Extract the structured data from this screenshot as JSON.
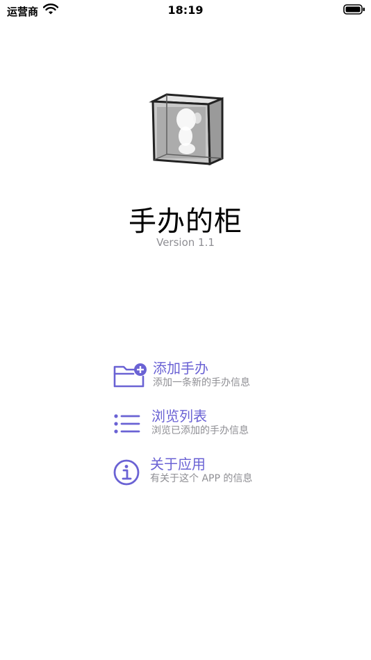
{
  "status": {
    "carrier": "运营商",
    "time": "18:19"
  },
  "app": {
    "title": "手办的柜",
    "version": "Version 1.1"
  },
  "menu": [
    {
      "label": "添加手办",
      "sub": "添加一条新的手办信息",
      "icon": "folder-add-icon"
    },
    {
      "label": "浏览列表",
      "sub": "浏览已添加的手办信息",
      "icon": "list-icon"
    },
    {
      "label": "关于应用",
      "sub": "有关于这个 APP 的信息",
      "icon": "info-icon"
    }
  ],
  "colors": {
    "accent": "#6a62d4",
    "subtext": "#8e8e93"
  }
}
